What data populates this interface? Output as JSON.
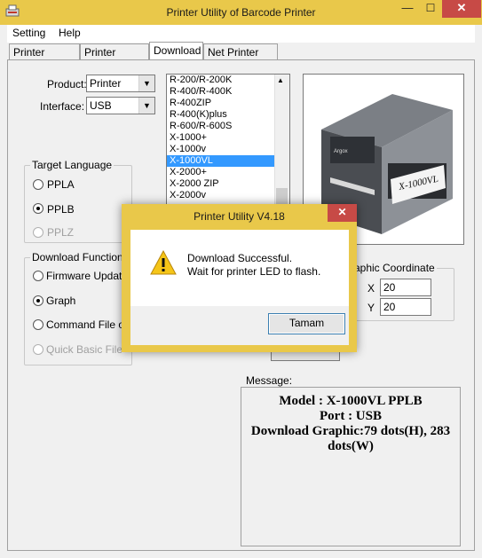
{
  "window": {
    "title": "Printer Utility of Barcode Printer",
    "close_glyph": "✕",
    "minimize_glyph": "—",
    "maximize_glyph": "☐"
  },
  "menu": {
    "items": [
      "Setting",
      "Help"
    ]
  },
  "tabs": [
    {
      "label": "Printer Setting",
      "active": false
    },
    {
      "label": "Printer Status",
      "active": false
    },
    {
      "label": "Download",
      "active": true
    },
    {
      "label": "Net Printer Info",
      "active": false
    }
  ],
  "product": {
    "label": "Product:",
    "value": "Printer"
  },
  "interface": {
    "label": "Interface:",
    "value": "USB"
  },
  "models": {
    "items": [
      "R-200/R-200K",
      "R-400/R-400K",
      "R-400ZIP",
      "R-400(K)plus",
      "R-600/R-600S",
      "X-1000+",
      "X-1000v",
      "X-1000VL",
      "X-2000+",
      "X-2000 ZIP",
      "X-2000v"
    ],
    "selected": "X-1000VL"
  },
  "printer_image": {
    "model_label": "X-1000VL",
    "brand_label": "Argox"
  },
  "target_language": {
    "title": "Target Language",
    "options": [
      {
        "label": "PPLA",
        "checked": false,
        "disabled": false
      },
      {
        "label": "PPLB",
        "checked": true,
        "disabled": false
      },
      {
        "label": "PPLZ",
        "checked": false,
        "disabled": true
      }
    ]
  },
  "download_function": {
    "title": "Download Function",
    "options": [
      {
        "label": "Firmware Update",
        "checked": false,
        "disabled": false
      },
      {
        "label": "Graph",
        "checked": true,
        "disabled": false
      },
      {
        "label": "Command File or C",
        "checked": false,
        "disabled": false
      },
      {
        "label": "Quick Basic File",
        "checked": false,
        "disabled": true
      }
    ]
  },
  "graphic_coordinate": {
    "title": "raphic Coordinate",
    "x_label": "X",
    "x_value": "20",
    "y_label": "Y",
    "y_value": "20"
  },
  "message": {
    "label": "Message:",
    "line1": "Model : X-1000VL PPLB",
    "line2": "Port : USB",
    "line3": "Download Graphic:79 dots(H), 283",
    "line4": "dots(W)"
  },
  "dialog": {
    "title": "Printer Utility V4.18",
    "close_glyph": "✕",
    "line1": "Download Successful.",
    "line2": "Wait for printer LED to flash.",
    "ok_label": "Tamam",
    "icon": "warning-icon"
  }
}
